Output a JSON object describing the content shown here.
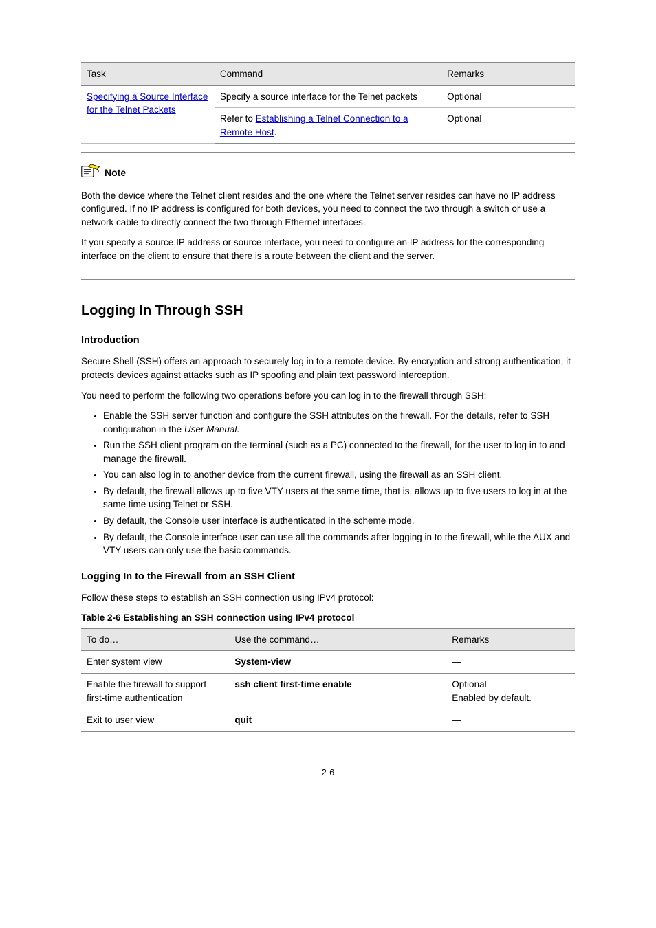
{
  "table1": {
    "headers": [
      "Task",
      "Command",
      "Remarks"
    ],
    "row": {
      "col1_link": "Specifying a Source Interface for the Telnet Packets",
      "cells": [
        [
          "Specify a source interface for the Telnet packets",
          "Optional"
        ],
        [
          "Refer to Establishing a Telnet Connection to a Remote Host.",
          "Optional"
        ]
      ]
    }
  },
  "note": {
    "label": "Note",
    "lines": [
      "Both the device where the Telnet client resides and the one where the Telnet server resides can have no IP address configured. If no IP address is configured for both devices, you need to connect the two through a switch or use a network cable to directly connect the two through Ethernet interfaces.",
      "If you specify a source IP address or source interface, you need to configure an IP address for the corresponding interface on the client to ensure that there is a route between the client and the server."
    ]
  },
  "section": {
    "heading": "Logging In Through SSH",
    "intro_title": "Introduction",
    "intro_body": "Secure Shell (SSH) offers an approach to securely log in to a remote device. By encryption and strong authentication, it protects devices against attacks such as IP spoofing and plain text password interception.",
    "setup_intro": "You need to perform the following two operations before you can log in to the firewall through SSH:",
    "bullets": [
      "Enable the SSH server function and configure the SSH attributes on the firewall. For the details, refer to SSH configuration in the User Manual.",
      "Run the SSH client program on the terminal (such as a PC) connected to the firewall, for the user to log in to and manage the firewall.",
      "You can also log in to another device from the current firewall, using the firewall as an SSH client.",
      "By default, the firewall allows up to five VTY users at the same time, that is, allows up to five users to log in at the same time using Telnet or SSH.",
      "By default, the Console user interface is authenticated in the scheme mode.",
      "By default, the Console interface user can use all the commands after logging in to the firewall, while the AUX and VTY users can only use the basic commands."
    ],
    "cfg_title": "Logging In to the Firewall from an SSH Client",
    "cfg_p1": "Follow these steps to establish an SSH connection using IPv4 protocol:",
    "caption": "Table 2-6 Establishing an SSH connection using IPv4 protocol",
    "table": {
      "headers": [
        "To do…",
        "Use the command…",
        "Remarks"
      ],
      "rows": [
        [
          "Enter system view",
          "System-view",
          "—"
        ],
        [
          "Enable the firewall to support first-time authentication",
          "ssh client first-time enable",
          "Optional\nEnabled by default."
        ],
        [
          "Exit to user view",
          "quit",
          "—"
        ]
      ]
    }
  },
  "page_num": "2-6"
}
